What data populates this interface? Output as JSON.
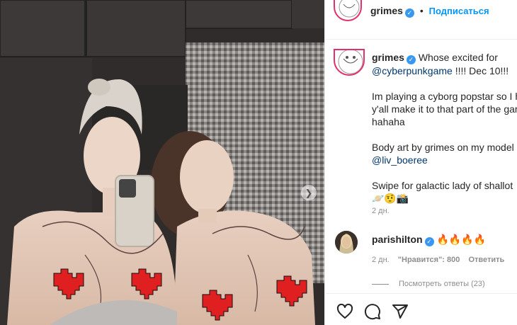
{
  "post": {
    "author": "grimes",
    "follow_label": "Подписаться",
    "separator": "•",
    "verified_icon": "verified-badge-icon"
  },
  "caption": {
    "author": "grimes",
    "line1": "Whose excited for",
    "mention1": "@cyberpunkgame",
    "line2": "!!!! Dec 10!!!",
    "para2_line1": "Im playing a cyborg popstar so I h",
    "para2_line2": "y'all make it to that part of the gar",
    "para2_line3": "hahaha",
    "para3_line1": "Body art by grimes on my model",
    "mention2": "@liv_boeree",
    "para4_line1": "Swipe for galactic lady of shallot",
    "emoji_line": "🪐🤨📸",
    "emoji_end": "🍀",
    "time": "2 дн."
  },
  "comment": {
    "author": "parishilton",
    "text": "🔥🔥🔥🔥",
    "time": "2 дн.",
    "likes": "\"Нравится\": 800",
    "reply_label": "Ответить",
    "view_replies": "Посмотреть ответы (23)"
  },
  "colors": {
    "link": "#00376b",
    "follow": "#0095f6",
    "meta": "#8e8e8e",
    "verified": "#3897f0"
  },
  "icons": [
    "heart-icon",
    "comment-icon",
    "share-icon",
    "next-slide-icon"
  ]
}
